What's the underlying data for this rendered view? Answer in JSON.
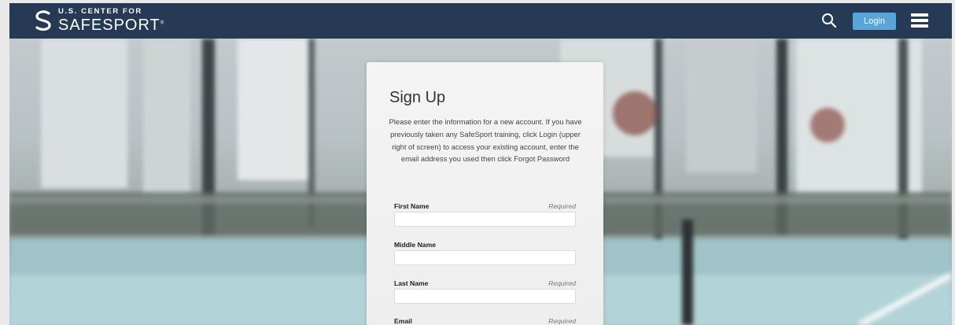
{
  "header": {
    "logo_line1": "U.S. CENTER FOR",
    "logo_line2": "SAFESPORT",
    "trademark": "®",
    "login_label": "Login",
    "search_icon": "search-icon",
    "menu_icon": "hamburger-menu-icon",
    "background_color": "#263a55",
    "accent_color": "#5ba4d8"
  },
  "signup": {
    "title": "Sign Up",
    "description": "Please enter the information for a new account. If you have previously taken any SafeSport training, click Login (upper right of screen) to access your existing account, enter the email address you used then click Forgot Password",
    "fields": [
      {
        "label": "First Name",
        "required": "Required",
        "value": ""
      },
      {
        "label": "Middle Name",
        "required": "",
        "value": ""
      },
      {
        "label": "Last Name",
        "required": "Required",
        "value": ""
      },
      {
        "label": "Email",
        "required": "Required",
        "value": ""
      }
    ]
  }
}
